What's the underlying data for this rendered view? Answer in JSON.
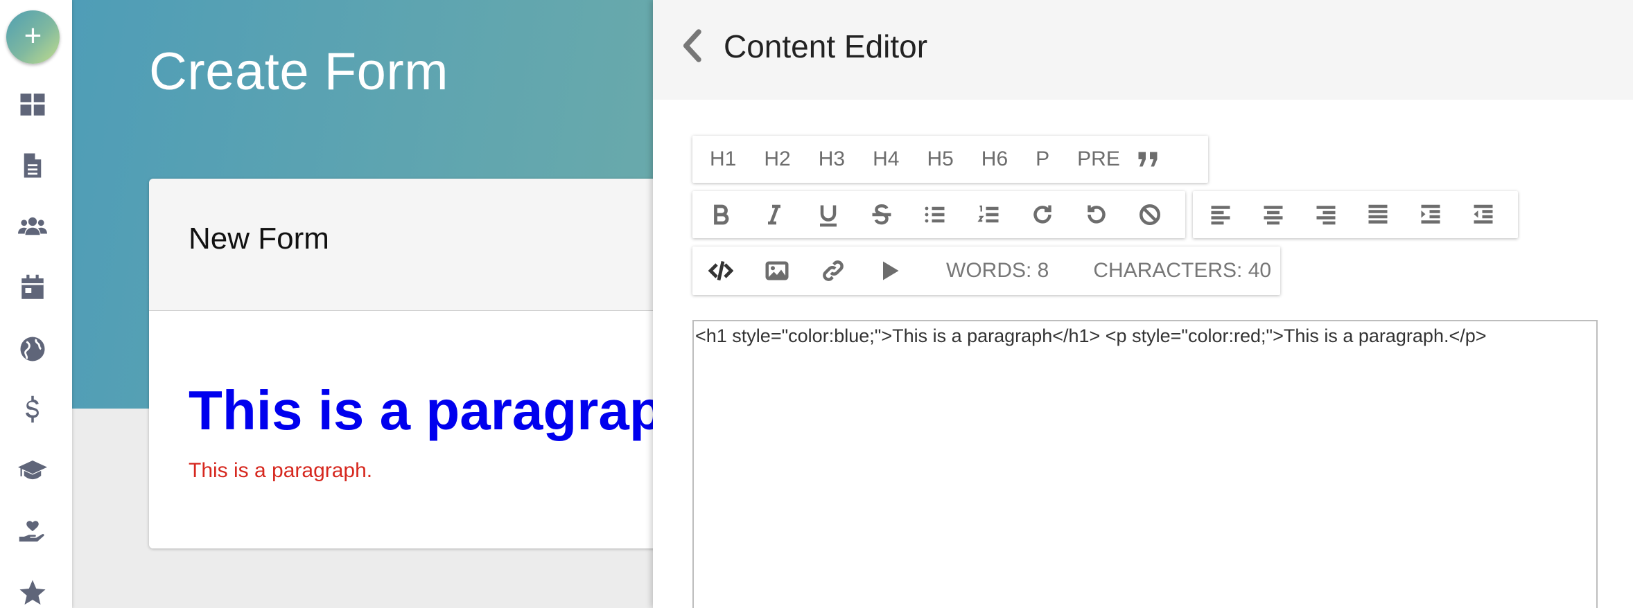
{
  "sidebar": {
    "add_label": "+",
    "items": [
      {
        "icon": "dashboard-icon"
      },
      {
        "icon": "document-icon"
      },
      {
        "icon": "users-icon"
      },
      {
        "icon": "calendar-icon"
      },
      {
        "icon": "globe-icon"
      },
      {
        "icon": "dollar-icon"
      },
      {
        "icon": "graduation-cap-icon"
      },
      {
        "icon": "hand-heart-icon"
      },
      {
        "icon": "star-icon"
      }
    ]
  },
  "page": {
    "title": "Create Form"
  },
  "form": {
    "title": "New Form",
    "preview_heading": "This is a paragraph",
    "preview_paragraph": "This is a paragraph."
  },
  "editor": {
    "title": "Content Editor",
    "heading_buttons": [
      "H1",
      "H2",
      "H3",
      "H4",
      "H5",
      "H6",
      "P",
      "PRE"
    ],
    "words_label": "WORDS: 8",
    "characters_label": "CHARACTERS: 40",
    "code": "<h1 style=\"color:blue;\">This is a paragraph</h1> <p style=\"color:red;\">This is a paragraph.</p>"
  },
  "colors": {
    "accent_start": "#4f9fb2",
    "accent_end": "#8dbf9a",
    "preview_heading": "#0000ee",
    "preview_paragraph": "#d6281f",
    "icon": "#5f6579"
  }
}
